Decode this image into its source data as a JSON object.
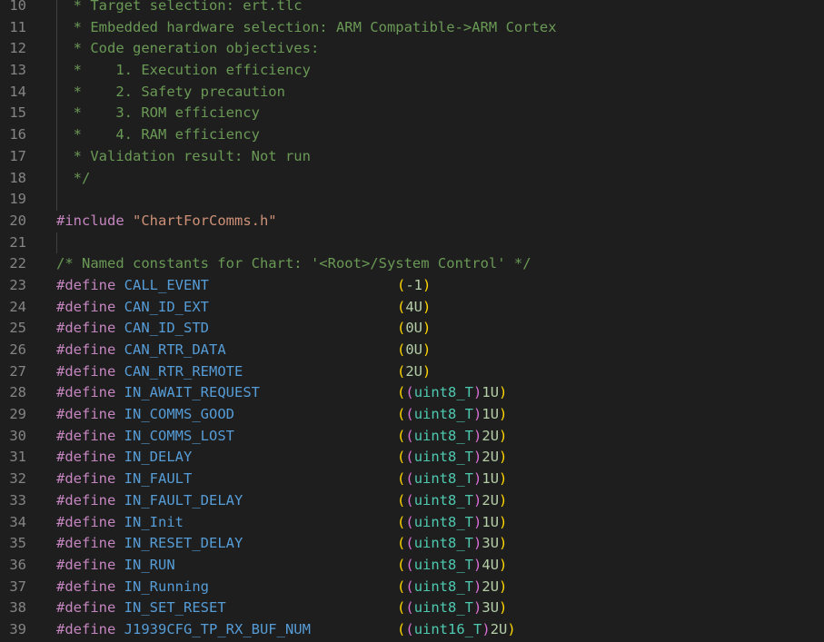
{
  "editor": {
    "lines": [
      {
        "num": "10",
        "kind": "comment",
        "text": "  * Target selection: ert.tlc"
      },
      {
        "num": "11",
        "kind": "comment",
        "text": "  * Embedded hardware selection: ARM Compatible->ARM Cortex"
      },
      {
        "num": "12",
        "kind": "comment",
        "text": "  * Code generation objectives:"
      },
      {
        "num": "13",
        "kind": "comment",
        "text": "  *    1. Execution efficiency"
      },
      {
        "num": "14",
        "kind": "comment",
        "text": "  *    2. Safety precaution"
      },
      {
        "num": "15",
        "kind": "comment",
        "text": "  *    3. ROM efficiency"
      },
      {
        "num": "16",
        "kind": "comment",
        "text": "  *    4. RAM efficiency"
      },
      {
        "num": "17",
        "kind": "comment",
        "text": "  * Validation result: Not run"
      },
      {
        "num": "18",
        "kind": "comment",
        "text": "  */"
      },
      {
        "num": "19",
        "kind": "blank",
        "text": ""
      },
      {
        "num": "20",
        "kind": "include",
        "directive": "#include",
        "file": "\"ChartForComms.h\""
      },
      {
        "num": "21",
        "kind": "blank",
        "text": ""
      },
      {
        "num": "22",
        "kind": "comment0",
        "text": "/* Named constants for Chart: '<Root>/System Control' */"
      },
      {
        "num": "23",
        "kind": "define",
        "name": "CALL_EVENT",
        "value": "-1",
        "cast": ""
      },
      {
        "num": "24",
        "kind": "define",
        "name": "CAN_ID_EXT",
        "value": "4U",
        "cast": ""
      },
      {
        "num": "25",
        "kind": "define",
        "name": "CAN_ID_STD",
        "value": "0U",
        "cast": ""
      },
      {
        "num": "26",
        "kind": "define",
        "name": "CAN_RTR_DATA",
        "value": "0U",
        "cast": ""
      },
      {
        "num": "27",
        "kind": "define",
        "name": "CAN_RTR_REMOTE",
        "value": "2U",
        "cast": ""
      },
      {
        "num": "28",
        "kind": "define",
        "name": "IN_AWAIT_REQUEST",
        "value": "1U",
        "cast": "uint8_T"
      },
      {
        "num": "29",
        "kind": "define",
        "name": "IN_COMMS_GOOD",
        "value": "1U",
        "cast": "uint8_T"
      },
      {
        "num": "30",
        "kind": "define",
        "name": "IN_COMMS_LOST",
        "value": "2U",
        "cast": "uint8_T"
      },
      {
        "num": "31",
        "kind": "define",
        "name": "IN_DELAY",
        "value": "2U",
        "cast": "uint8_T"
      },
      {
        "num": "32",
        "kind": "define",
        "name": "IN_FAULT",
        "value": "1U",
        "cast": "uint8_T"
      },
      {
        "num": "33",
        "kind": "define",
        "name": "IN_FAULT_DELAY",
        "value": "2U",
        "cast": "uint8_T"
      },
      {
        "num": "34",
        "kind": "define",
        "name": "IN_Init",
        "value": "1U",
        "cast": "uint8_T"
      },
      {
        "num": "35",
        "kind": "define",
        "name": "IN_RESET_DELAY",
        "value": "3U",
        "cast": "uint8_T"
      },
      {
        "num": "36",
        "kind": "define",
        "name": "IN_RUN",
        "value": "4U",
        "cast": "uint8_T"
      },
      {
        "num": "37",
        "kind": "define",
        "name": "IN_Running",
        "value": "2U",
        "cast": "uint8_T"
      },
      {
        "num": "38",
        "kind": "define",
        "name": "IN_SET_RESET",
        "value": "3U",
        "cast": "uint8_T"
      },
      {
        "num": "39",
        "kind": "define",
        "name": "J1939CFG_TP_RX_BUF_NUM",
        "value": "2U",
        "cast": "uint16_T"
      }
    ],
    "define_keyword": "#define"
  }
}
